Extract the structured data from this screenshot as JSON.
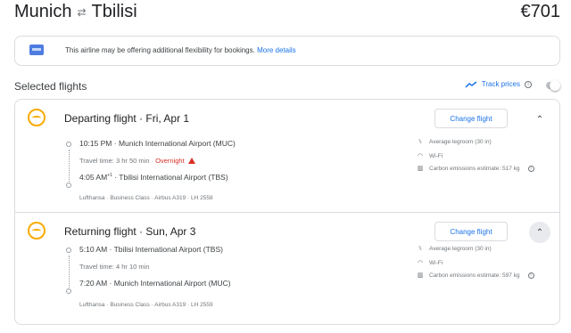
{
  "header": {
    "origin": "Munich",
    "destination": "Tbilisi",
    "swap_icon": "swap-arrows-icon",
    "price": "€701"
  },
  "notice": {
    "text": "This airline may be offering additional flexibility for bookings.",
    "link": "More details",
    "icon": "ticket-icon"
  },
  "selected": {
    "label": "Selected flights",
    "track_label": "Track prices",
    "track_enabled": false
  },
  "departing": {
    "title": "Departing flight",
    "date": "Fri, Apr 1",
    "change_label": "Change flight",
    "dep_time": "10:15 PM",
    "dep_airport": "Munich International Airport (MUC)",
    "travel_time": "Travel time: 3 hr 50 min",
    "overnight": "Overnight",
    "arr_time": "4:05 AM",
    "arr_plus": "+1",
    "arr_airport": "Tbilisi International Airport (TBS)",
    "meta": "Lufthansa · Business Class · Airbus A319 · LH 2558",
    "legroom": "Average legroom (30 in)",
    "wifi": "Wi-Fi",
    "emissions": "Carbon emissions estimate: 517 kg"
  },
  "returning": {
    "title": "Returning flight",
    "date": "Sun, Apr 3",
    "change_label": "Change flight",
    "dep_time": "5:10 AM",
    "dep_airport": "Tbilisi International Airport (TBS)",
    "travel_time": "Travel time: 4 hr 10 min",
    "arr_time": "7:20 AM",
    "arr_airport": "Munich International Airport (MUC)",
    "meta": "Lufthansa · Business Class · Airbus A319 · LH 2559",
    "legroom": "Average legroom (30 in)",
    "wifi": "Wi-Fi",
    "emissions": "Carbon emissions estimate: 597 kg"
  },
  "colors": {
    "accent": "#1a73e8",
    "lufthansa": "#f9ab00",
    "warning": "#d93025"
  }
}
